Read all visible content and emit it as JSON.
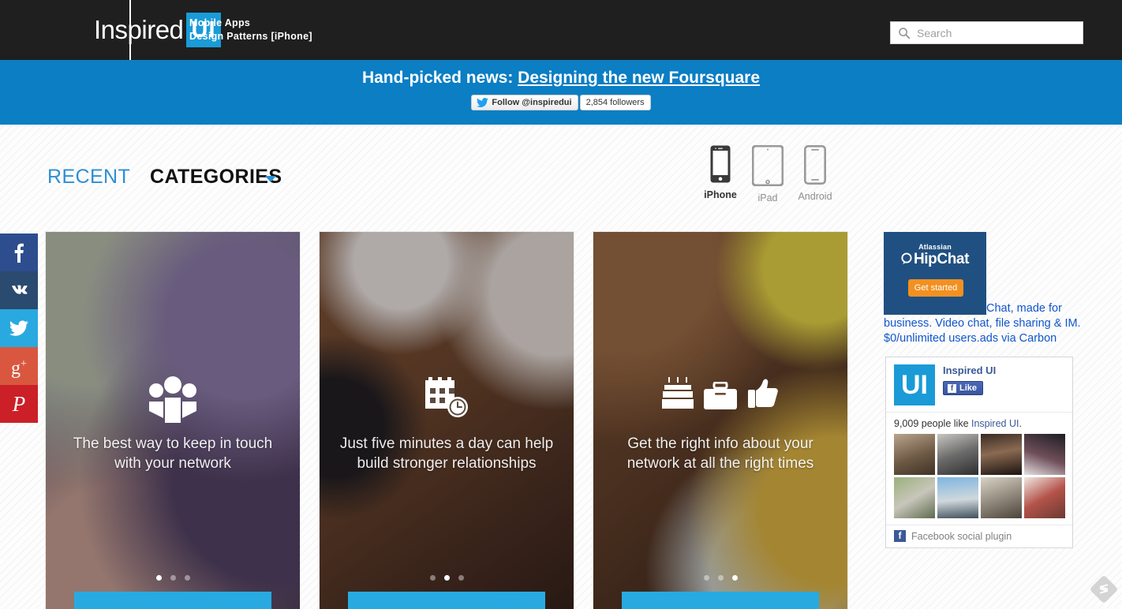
{
  "header": {
    "logo_text": "Inspired",
    "logo_badge": "UI",
    "tagline_line1": "Mobile Apps",
    "tagline_line2": "Design Patterns [iPhone]",
    "search_placeholder": "Search",
    "search_value": "",
    "search_icon": "search-icon",
    "bg_color": "#1f1f1f",
    "accent_color": "#1a9bd7"
  },
  "banner": {
    "lead_text": "Hand-picked news: ",
    "link_text": "Designing the new Foursquare",
    "twitter_follow_label": "Follow @inspiredui",
    "twitter_followers": "2,854 followers",
    "bg_color": "#0b7ec4"
  },
  "nav": {
    "tabs": [
      {
        "label": "RECENT",
        "active": true
      },
      {
        "label": "CATEGORIES",
        "active": false,
        "has_caret": true
      }
    ],
    "devices": [
      {
        "label": "iPhone",
        "icon": "iphone-icon",
        "active": true
      },
      {
        "label": "iPad",
        "icon": "ipad-icon",
        "active": false
      },
      {
        "label": "Android",
        "icon": "android-icon",
        "active": false
      }
    ]
  },
  "social_rail": [
    {
      "name": "facebook-icon",
      "glyph": "f",
      "color": "#2d4d8e"
    },
    {
      "name": "vk-icon",
      "glyph": "VK",
      "color": "#2b4a6f"
    },
    {
      "name": "twitter-icon",
      "glyph": "t",
      "color": "#29a9e0"
    },
    {
      "name": "googleplus-icon",
      "glyph": "g+",
      "color": "#d9573f"
    },
    {
      "name": "pinterest-icon",
      "glyph": "P",
      "color": "#cb2027"
    }
  ],
  "cards": [
    {
      "caption": "The best way to keep in touch with your network",
      "icons": [
        "people-group-icon"
      ],
      "dots": 3,
      "active_dot": 0,
      "cta_color": "#28aae1"
    },
    {
      "caption": "Just five minutes a day can help build stronger relationships",
      "icons": [
        "calendar-clock-icon"
      ],
      "dots": 3,
      "active_dot": 1,
      "cta_color": "#28aae1"
    },
    {
      "caption": "Get the right info about your network at all the right times",
      "icons": [
        "birthday-cake-icon",
        "briefcase-icon",
        "thumbs-up-icon"
      ],
      "dots": 3,
      "active_dot": 2,
      "cta_color": "#28aae1"
    }
  ],
  "sidebar": {
    "ad": {
      "brand_small": "Atlassian",
      "brand_main": "HipChat",
      "button_label": "Get started",
      "text_line1": "Chat, made for",
      "text_line2": "business. Video chat, file sharing & IM.",
      "text_line3": "$0/unlimited users.ads via Carbon",
      "tile_color": "#205081",
      "button_color": "#f29121",
      "text_color": "#1155cc"
    },
    "facebook": {
      "logo_text": "UI",
      "page_name": "Inspired UI",
      "like_label": "Like",
      "count_prefix": "9,009 people like ",
      "count_link": "Inspired UI",
      "count_suffix": ".",
      "footer_label": "Facebook social plugin",
      "faces": 8
    }
  },
  "footer_widget": {
    "feedly_label": "feedly-icon"
  }
}
